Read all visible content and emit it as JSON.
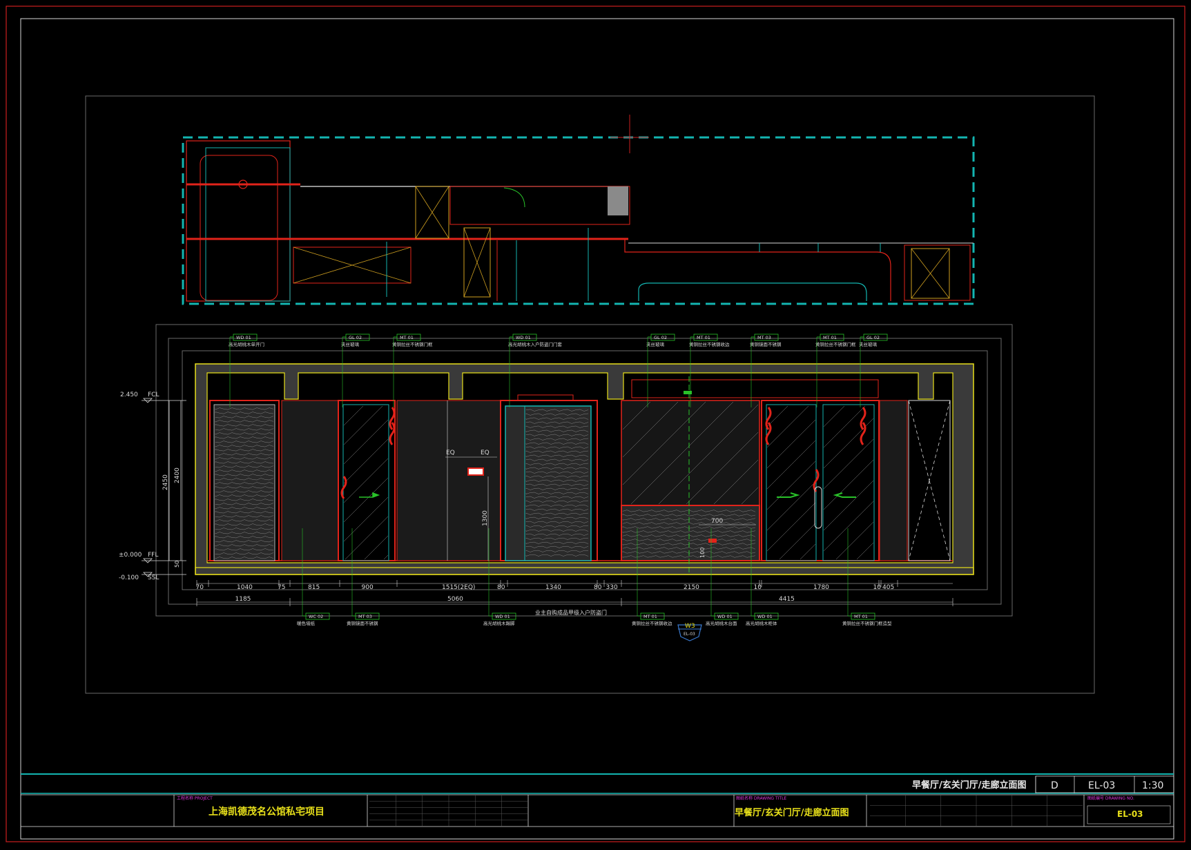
{
  "colors": {
    "background": "#000000",
    "frame_red": "#cc1f1f",
    "frame_white": "#d9d9d9",
    "cyan": "#13b5b1",
    "red": "#e2231a",
    "yellow": "#e8e01a",
    "green": "#29c229",
    "magenta": "#e23adf",
    "gray": "#8a8a8a",
    "wall_fill": "#3a3a3a"
  },
  "title_block": {
    "drawing_title": "早餐厅/玄关门厅/走廊立面图",
    "revision": "D",
    "sheet_no": "EL-03",
    "scale": "1:30",
    "project_label": "工程名称 PROJECT",
    "project_name": "上海凯德茂名公馆私宅项目",
    "drawing_name_label": "图纸名称 DRAWING TITLE",
    "drawing_name": "早餐厅/玄关门厅/走廊立面图",
    "sheet_label": "图纸编号 DRAWING NO.",
    "sheet_value": "EL-03"
  },
  "levels": [
    {
      "elev": "2.450",
      "tag": "FCL"
    },
    {
      "elev": "±0.000",
      "tag": "FFL"
    },
    {
      "elev": "-0.100",
      "tag": "SSL"
    }
  ],
  "vertical_dims": [
    "2450",
    "2400",
    "50",
    "1300",
    "100"
  ],
  "top_tags": [
    {
      "code": "WD 01",
      "desc": "高光胡桃木单开门"
    },
    {
      "code": "GL 02",
      "desc": "夹丝玻璃"
    },
    {
      "code": "MT 01",
      "desc": "黄铜拉丝不锈钢门框"
    },
    {
      "code": "WD 01",
      "desc": "高光胡桃木入户防盗门门套"
    },
    {
      "code": "GL 02",
      "desc": "夹丝玻璃"
    },
    {
      "code": "MT 01",
      "desc": "黄铜拉丝不锈钢收边"
    },
    {
      "code": "MT 03",
      "desc": "黄铜镜面不锈钢"
    },
    {
      "code": "MT 01",
      "desc": "黄铜拉丝不锈钢门框"
    },
    {
      "code": "GL 02",
      "desc": "夹丝玻璃"
    }
  ],
  "bottom_tags": [
    {
      "code": "WC 02",
      "desc": "暖色墙纸"
    },
    {
      "code": "MT 03",
      "desc": "黄铜镜面不锈钢"
    },
    {
      "code": "WD 01",
      "desc": "高光胡桃木踢脚"
    },
    {
      "code": "MT 01",
      "desc": "黄铜拉丝不锈钢收边"
    },
    {
      "code": "WD 01",
      "desc": "高光胡桃木台面"
    },
    {
      "code": "WD 01",
      "desc": "高光胡桃木柜体"
    },
    {
      "code": "MT 01",
      "desc": "黄铜拉丝不锈钢门框造型"
    }
  ],
  "note_center": "业主自购成品甲级入户防盗门",
  "dims_row1": [
    "70",
    "1040",
    "75",
    "815",
    "900",
    "1515(2EQ)",
    "80",
    "1340",
    "80",
    "330",
    "2150",
    "10",
    "1780",
    "10",
    "405"
  ],
  "dims_row2": [
    "1185",
    "5060",
    "4415"
  ],
  "eq_labels": [
    "EQ",
    "EQ"
  ],
  "inline_dim": "700",
  "section_marker": {
    "top": "W3",
    "bottom": "EL-03"
  }
}
